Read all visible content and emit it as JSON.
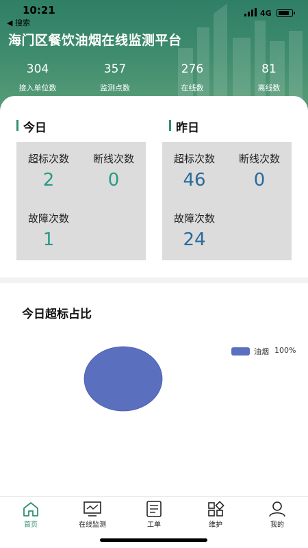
{
  "status_bar": {
    "time": "10:21",
    "back_label": "◀ 搜索",
    "network": "4G"
  },
  "app_title": "海门区餐饮油烟在线监测平台",
  "stats": [
    {
      "value": "304",
      "label": "接入单位数"
    },
    {
      "value": "357",
      "label": "监测点数"
    },
    {
      "value": "276",
      "label": "在线数"
    },
    {
      "value": "81",
      "label": "离线数"
    }
  ],
  "today": {
    "title": "今日",
    "exceed_label": "超标次数",
    "exceed_value": "2",
    "offline_label": "断线次数",
    "offline_value": "0",
    "fault_label": "故障次数",
    "fault_value": "1"
  },
  "yesterday": {
    "title": "昨日",
    "exceed_label": "超标次数",
    "exceed_value": "46",
    "offline_label": "断线次数",
    "offline_value": "0",
    "fault_label": "故障次数",
    "fault_value": "24"
  },
  "chart_title": "今日超标占比",
  "chart_data": {
    "type": "pie",
    "categories": [
      "油烟"
    ],
    "values": [
      100
    ],
    "legend": [
      {
        "name": "油烟",
        "percent": "100%"
      }
    ],
    "legend_position": "top-right",
    "colors": [
      "#5b6fbf"
    ]
  },
  "tabs": [
    {
      "label": "首页",
      "icon": "home-icon",
      "active": true
    },
    {
      "label": "在线监测",
      "icon": "monitor-icon",
      "active": false
    },
    {
      "label": "工单",
      "icon": "document-icon",
      "active": false
    },
    {
      "label": "维护",
      "icon": "grid-icon",
      "active": false
    },
    {
      "label": "我的",
      "icon": "user-icon",
      "active": false
    }
  ],
  "colors": {
    "header_green": "#3f8c6e",
    "accent": "#2f8f70",
    "value_teal": "#2a9a86",
    "value_blue": "#2a6b9a",
    "pie": "#5b6fbf",
    "box_bg": "#dcdcdc"
  }
}
